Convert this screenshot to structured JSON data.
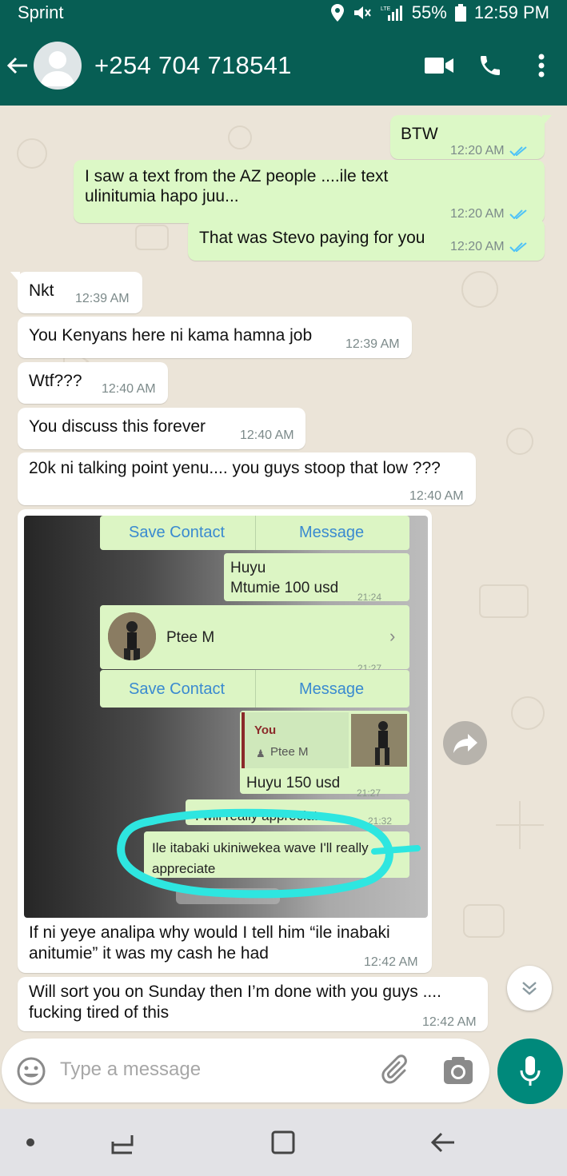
{
  "status": {
    "carrier": "Sprint",
    "network": "LTE",
    "battery": "55%",
    "time": "12:59 PM"
  },
  "header": {
    "contact": "+254 704 718541",
    "icons": [
      "back-arrow-icon",
      "avatar",
      "video-call-icon",
      "phone-icon",
      "more-vertical-icon"
    ]
  },
  "messages": [
    {
      "dir": "out",
      "text": "BTW",
      "time": "12:20 AM",
      "read": true
    },
    {
      "dir": "out",
      "lines": [
        "I saw a text from the AZ people ....ile text",
        "ulinitumia hapo juu..."
      ],
      "time": "12:20 AM",
      "read": true
    },
    {
      "dir": "out",
      "text": "That was Stevo paying for you",
      "time": "12:20 AM",
      "read": true
    },
    {
      "dir": "in",
      "text": "Nkt",
      "time": "12:39 AM"
    },
    {
      "dir": "in",
      "text": "You Kenyans here ni kama hamna job",
      "time": "12:39 AM"
    },
    {
      "dir": "in",
      "text": "Wtf???",
      "time": "12:40 AM"
    },
    {
      "dir": "in",
      "text": "You discuss this forever",
      "time": "12:40 AM"
    },
    {
      "dir": "in",
      "text": "20k ni talking point yenu.... you guys stoop that low ???",
      "time": "12:40 AM"
    },
    {
      "dir": "in",
      "type": "image",
      "caption": [
        "If ni yeye analipa why would I tell him “ile inabaki",
        "anitumie” it was my cash he had"
      ],
      "time": "12:42 AM",
      "screenshot": {
        "save_contact": "Save Contact",
        "message": "Message",
        "bubble1": [
          "Huyu",
          "Mtumie 100 usd"
        ],
        "bubble1_time": "21:24",
        "contact_name": "Ptee M",
        "contact_time": "21:27",
        "reply_author": "You",
        "reply_contact": "Ptee M",
        "bubble2": "Huyu 150 usd",
        "bubble2_time": "21:27",
        "partial1": "I will really appreciate",
        "partial1_time": "21:32",
        "partial2": "Ile itabaki ukiniwekea wave I'll really appreciate"
      }
    },
    {
      "dir": "in",
      "lines": [
        "Will sort you on Sunday then I’m done with you guys ....",
        "fucking tired of this"
      ],
      "time": "12:42 AM"
    }
  ],
  "input": {
    "placeholder": "Type a message"
  },
  "colors": {
    "header": "#075e54",
    "outgoing": "#dcf8c6",
    "incoming": "#ffffff",
    "read_tick": "#4fc3f7",
    "mic": "#00897b",
    "highlight": "#2ee6e0"
  }
}
